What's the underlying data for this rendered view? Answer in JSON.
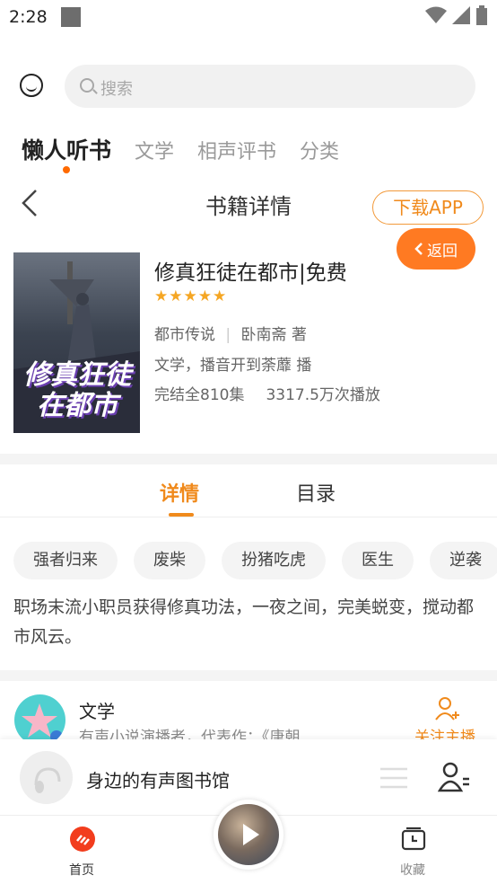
{
  "status": {
    "time": "2:28"
  },
  "search": {
    "placeholder": "搜索"
  },
  "top_tabs": [
    "懒人听书",
    "文学",
    "相声评书",
    "分类"
  ],
  "header": {
    "title": "书籍详情",
    "download_label": "下载APP",
    "return_label": "返回"
  },
  "book": {
    "cover_text": "修真狂徒在都市",
    "title": "修真狂徒在都市|免费",
    "rating_stars": 5,
    "category": "都市传说",
    "author": "卧南斋 著",
    "narrator_line": "文学，播音开到荼蘼 播",
    "episodes": "完结全810集",
    "plays": "3317.5万次播放"
  },
  "detail_tabs": {
    "detail": "详情",
    "toc": "目录"
  },
  "tags": [
    "强者归来",
    "废柴",
    "扮猪吃虎",
    "医生",
    "逆袭"
  ],
  "description": "职场末流小职员获得修真功法，一夜之间，完美蜕变，搅动都市风云。",
  "author_card": {
    "name": "文学",
    "desc": "有声小说演播者，代表作：《唐朝…",
    "follow_label": "关注主播"
  },
  "player": {
    "title": "身边的有声图书馆"
  },
  "bottom_nav": {
    "home": "首页",
    "favorites": "收藏"
  },
  "colors": {
    "accent": "#f08a1c",
    "return_bg": "#ff7a22",
    "home_icon": "#f23d1d"
  }
}
